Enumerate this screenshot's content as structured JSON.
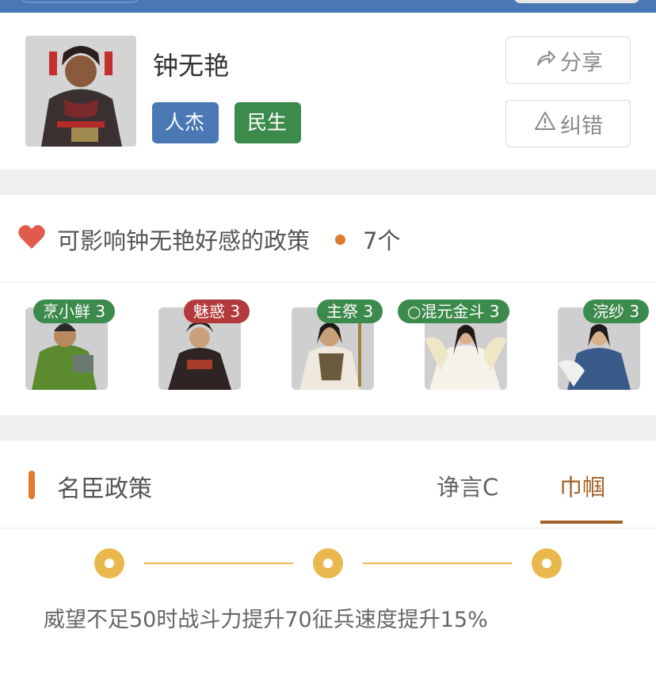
{
  "profile": {
    "name": "钟无艳",
    "tags": [
      "人杰",
      "民生"
    ],
    "share_label": "分享",
    "report_label": "纠错"
  },
  "policies": {
    "heading": "可影响钟无艳好感的政策",
    "count": "7个",
    "items": [
      {
        "label": "烹小鲜 3",
        "color": "green"
      },
      {
        "label": "魅惑 3",
        "color": "red"
      },
      {
        "label": "主祭 3",
        "color": "green"
      },
      {
        "label": "○混元金斗 3",
        "color": "green"
      },
      {
        "label": "浣纱 3",
        "color": "green"
      }
    ]
  },
  "ministers": {
    "title": "名臣政策",
    "tabs": [
      "诤言C",
      "巾帼"
    ],
    "active_tab": "巾帼",
    "effect_text": "威望不足50时战斗力提升70征兵速度提升15%"
  },
  "colors": {
    "brand_blue": "#4a78b4",
    "tag_green": "#3d8a4d",
    "badge_red": "#b33a3a",
    "accent_orange": "#e07a2f",
    "active_tab": "#a3622a",
    "node_gold": "#e8b84c"
  }
}
